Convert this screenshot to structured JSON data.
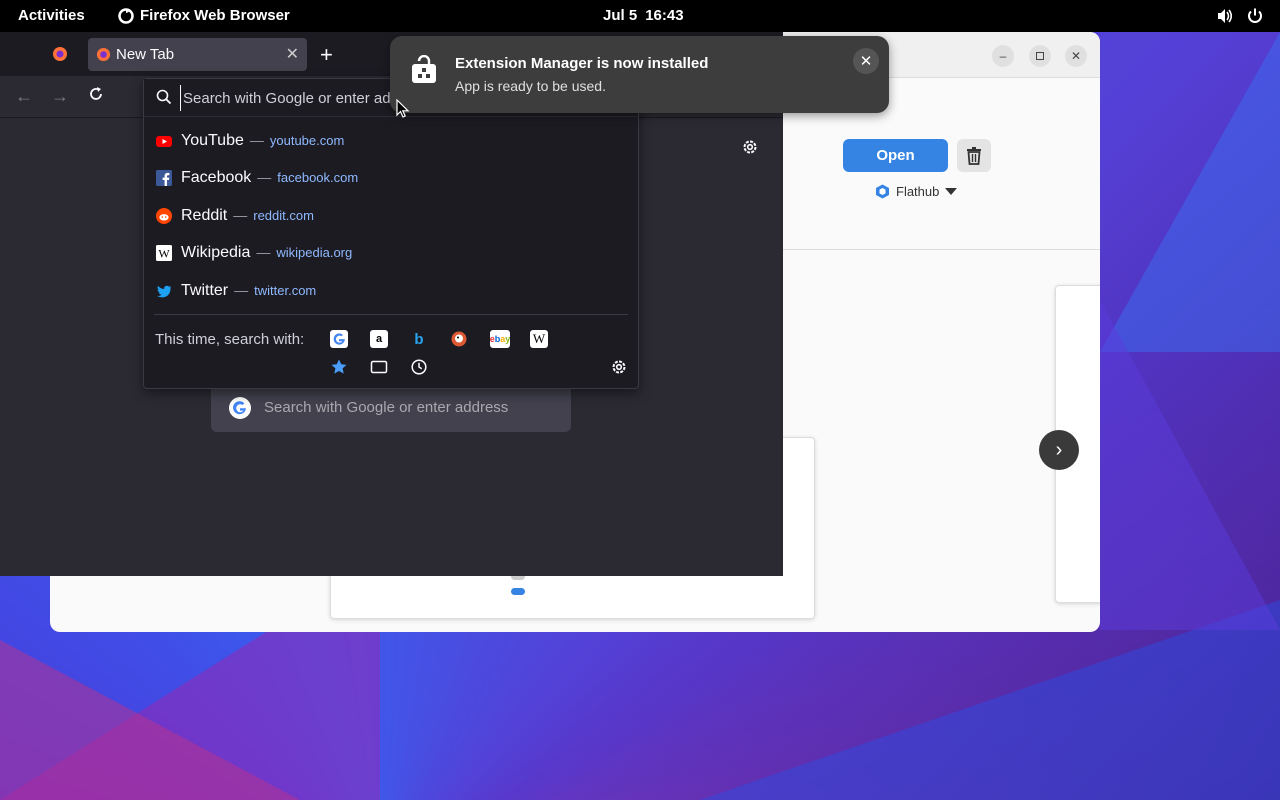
{
  "topbar": {
    "activities": "Activities",
    "app_name": "Firefox Web Browser",
    "date": "Jul 5",
    "time": "16:43"
  },
  "software_window": {
    "open_label": "Open",
    "source_label": "Flathub"
  },
  "firefox": {
    "tab_title": "New Tab",
    "url_placeholder": "Search with Google or enter address",
    "newtab_search_placeholder": "Search with Google or enter address",
    "suggestions": [
      {
        "name": "YouTube",
        "url": "youtube.com",
        "icon": "youtube-icon",
        "color": "#ff0000"
      },
      {
        "name": "Facebook",
        "url": "facebook.com",
        "icon": "facebook-icon",
        "color": "#3b5998"
      },
      {
        "name": "Reddit",
        "url": "reddit.com",
        "icon": "reddit-icon",
        "color": "#ff4500"
      },
      {
        "name": "Wikipedia",
        "url": "wikipedia.org",
        "icon": "wikipedia-icon",
        "color": "#ffffff"
      },
      {
        "name": "Twitter",
        "url": "twitter.com",
        "icon": "twitter-icon",
        "color": "#1da1f2"
      }
    ],
    "search_with_label": "This time, search with:",
    "engines": [
      "google-icon",
      "amazon-icon",
      "bing-icon",
      "duckduckgo-icon",
      "ebay-icon",
      "wikipedia-icon"
    ],
    "dash": "—"
  },
  "notification": {
    "title": "Extension Manager is now installed",
    "body": "App is ready to be used."
  },
  "colors": {
    "accent": "#3584e4",
    "link": "#8fb9ff",
    "firefox_bg": "#2b2a33"
  }
}
